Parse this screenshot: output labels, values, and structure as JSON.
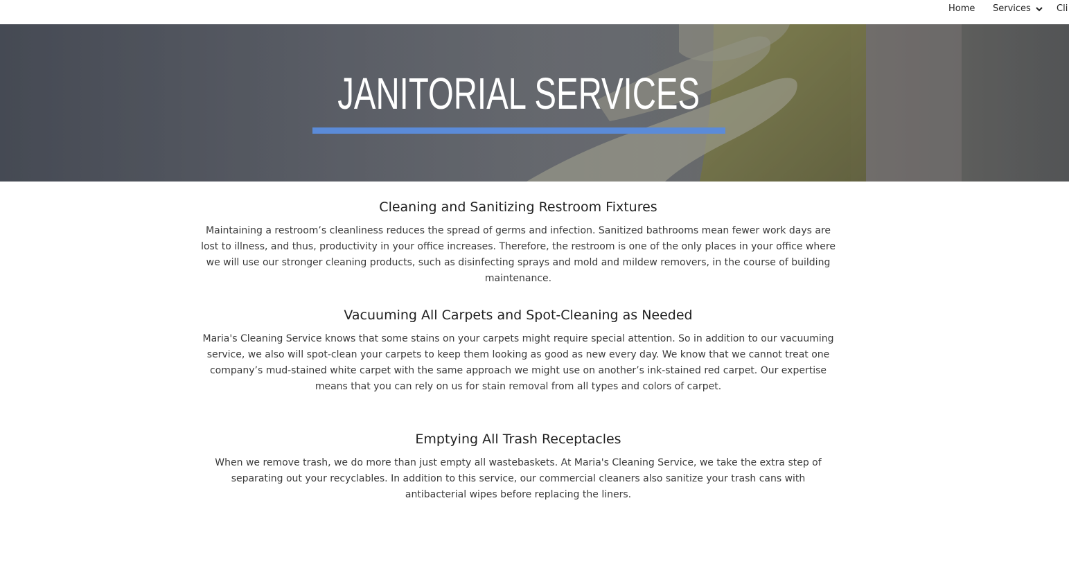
{
  "nav": {
    "home": "Home",
    "services": "Services",
    "clients": "Cli"
  },
  "hero": {
    "title": "JANITORIAL SERVICES",
    "accent_color": "#5b8bd8"
  },
  "sections": [
    {
      "heading": "Cleaning and Sanitizing Restroom Fixtures",
      "body": "Maintaining a restroom’s cleanliness reduces the spread of germs and infection. Sanitized bathrooms mean fewer work days are lost to illness, and thus, productivity in your office increases. Therefore, the restroom is one of the only places in your office where we will use our stronger cleaning products, such as disinfecting sprays and mold and mildew removers, in the course of building maintenance."
    },
    {
      "heading": "Vacuuming All Carpets and Spot-Cleaning as Needed",
      "body": "Maria's Cleaning Service knows that some stains on your carpets might require special attention. So in addition to our vacuuming service, we also will spot-clean your carpets to keep them looking as good as new every day. We know that we cannot treat one company’s mud-stained white carpet with the same approach we might use on another’s ink-stained red carpet. Our expertise means that you can rely on us for stain removal from all types and colors of carpet."
    },
    {
      "heading": "Emptying All Trash Receptacles",
      "body": "When we remove trash, we do more than just empty all wastebaskets. At Maria's Cleaning Service, we take the extra step of separating out your recyclables. In addition to this service, our commercial cleaners also sanitize your trash cans with antibacterial wipes before replacing the liners."
    }
  ]
}
